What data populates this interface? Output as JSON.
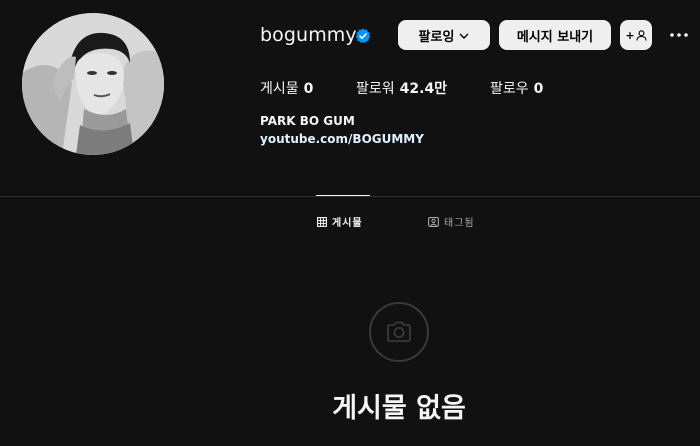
{
  "profile": {
    "username": "bogummy",
    "verified": true,
    "follow_button": "팔로잉",
    "message_button": "메시지 보내기",
    "add_user_glyph": "+",
    "stats": {
      "posts_label": "게시물",
      "posts_count": "0",
      "followers_label": "팔로워",
      "followers_count": "42.4만",
      "following_label": "팔로우",
      "following_count": "0"
    },
    "bio_name": "PARK BO GUM",
    "bio_link": "youtube.com/BOGUMMY"
  },
  "tabs": [
    {
      "label": "게시물",
      "icon": "grid-icon",
      "active": true
    },
    {
      "label": "태그됨",
      "icon": "tag-user-icon",
      "active": false
    }
  ],
  "empty_state": {
    "icon": "camera-icon",
    "title": "게시물 없음"
  },
  "colors": {
    "background": "#111111",
    "text": "#f5f5f5",
    "button_bg": "#efefef",
    "verified_blue": "#0095f6",
    "link": "#e0f1ff",
    "muted": "#a8a8a8"
  }
}
